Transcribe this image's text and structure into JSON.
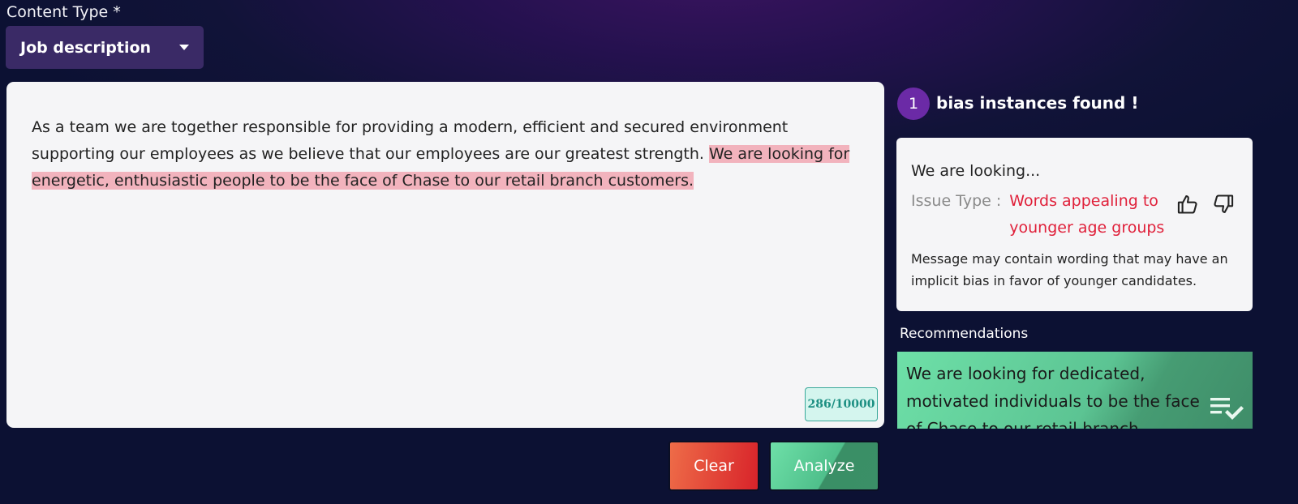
{
  "content_type": {
    "label": "Content Type *",
    "selected": "Job description"
  },
  "editor": {
    "text_plain": "As a team we are together responsible for providing a modern, efficient and secured environment supporting our employees as we believe that our employees are our greatest strength. ",
    "text_highlighted": "We are looking for energetic, enthusiastic people to be the face of Chase to our retail branch customers.",
    "char_count": "286/10000"
  },
  "actions": {
    "clear_label": "Clear",
    "analyze_label": "Analyze"
  },
  "results": {
    "count": "1",
    "summary": "bias instances found !",
    "issue": {
      "title": "We are looking...",
      "type_label": "Issue Type :",
      "type_value": "Words appealing to younger age groups",
      "message": "Message may contain wording that may have an implicit bias in favor of younger candidates."
    },
    "recommendations_label": "Recommendations",
    "recommendation_text": "We are looking for dedicated, motivated individuals to be the face of Chase to our retail branch customers."
  },
  "icons": {
    "dropdown": "caret-down-icon",
    "like": "thumbs-up-icon",
    "dislike": "thumbs-down-icon",
    "apply": "playlist-check-icon"
  },
  "colors": {
    "highlight": "#f2b3bd",
    "issue_type": "#e0203a",
    "clear_button": "#d8232a",
    "analyze_button": "#4fbf8b",
    "count_badge": "#6b2aa6"
  }
}
